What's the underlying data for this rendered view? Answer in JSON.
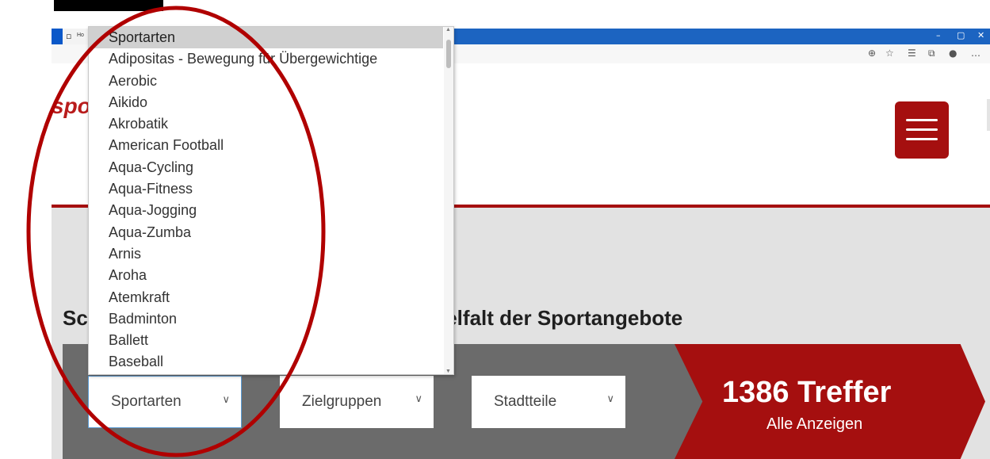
{
  "browser": {
    "tab_title": "Ho",
    "tab_icon": "page-icon",
    "window_controls": [
      "–",
      "▢",
      "✕"
    ],
    "toolbar_icons": [
      "zoom-icon",
      "read-aloud-icon",
      "favorites-icon",
      "collections-icon",
      "profile-icon",
      "more-icon"
    ]
  },
  "header": {
    "logo_fragment": "spo",
    "menu_icon": "hamburger-icon",
    "accent_color": "#a50f0f"
  },
  "hero": {
    "headline_left": "Sc",
    "headline_right": "ielfalt der Sportangebote"
  },
  "filters": [
    {
      "label": "Sportarten",
      "icon": "chevron-down-icon"
    },
    {
      "label": "Zielgruppen",
      "icon": "chevron-down-icon"
    },
    {
      "label": "Stadtteile",
      "icon": "chevron-down-icon"
    }
  ],
  "result": {
    "count": "1386 Treffer",
    "show_all": "Alle Anzeigen"
  },
  "dropdown": {
    "selected": "Sportarten",
    "options": [
      "Sportarten",
      "Adipositas - Bewegung für Übergewichtige",
      "Aerobic",
      "Aikido",
      "Akrobatik",
      "American Football",
      "Aqua-Cycling",
      "Aqua-Fitness",
      "Aqua-Jogging",
      "Aqua-Zumba",
      "Arnis",
      "Aroha",
      "Atemkraft",
      "Badminton",
      "Ballett",
      "Baseball"
    ]
  }
}
